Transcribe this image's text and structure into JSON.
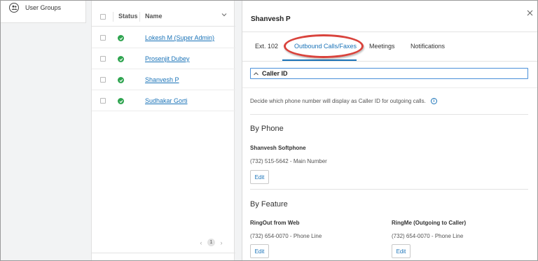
{
  "sidenav": {
    "items": [
      {
        "label": "User Groups",
        "icon": "users-icon"
      }
    ]
  },
  "users_table": {
    "headers": {
      "status": "Status",
      "name": "Name"
    },
    "rows": [
      {
        "name": "Lokesh M (Super Admin)",
        "status": "active"
      },
      {
        "name": "Prosenjit Dubey",
        "status": "active"
      },
      {
        "name": "Shanvesh P",
        "status": "active"
      },
      {
        "name": "Sudhakar Gorti",
        "status": "active"
      }
    ],
    "pagination": {
      "current_page": "1"
    }
  },
  "panel": {
    "title": "Shanvesh P",
    "tabs": [
      {
        "label": "Ext. 102"
      },
      {
        "label": "Outbound Calls/Faxes"
      },
      {
        "label": "Meetings"
      },
      {
        "label": "Notifications"
      }
    ],
    "active_tab": "Outbound Calls/Faxes",
    "section": {
      "title": "Caller ID",
      "description": "Decide which phone number will display as Caller ID for outgoing calls."
    },
    "by_phone": {
      "heading": "By Phone",
      "device": "Shanvesh Softphone",
      "number": "(732) 515-5642 - Main Number",
      "edit_label": "Edit"
    },
    "by_feature": {
      "heading": "By Feature",
      "features": [
        {
          "name": "RingOut from Web",
          "number": "(732) 654-0070 - Phone Line",
          "edit_label": "Edit"
        },
        {
          "name": "RingMe (Outgoing to Caller)",
          "number": "(732) 654-0070 - Phone Line",
          "edit_label": "Edit"
        }
      ]
    }
  },
  "colors": {
    "accent": "#1a73b8",
    "status_active": "#2ea44f",
    "highlight": "#d9433c"
  }
}
